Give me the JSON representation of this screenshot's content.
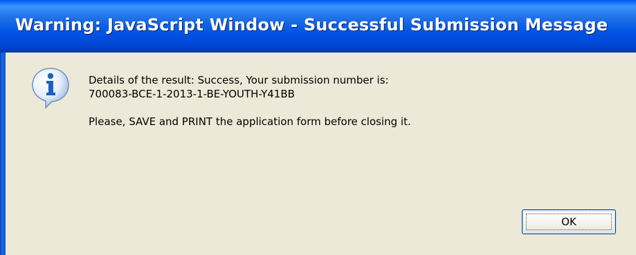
{
  "window": {
    "title": "Warning: JavaScript Window - Successful Submission Message"
  },
  "dialog": {
    "icon": "info-balloon-icon",
    "message_line_1": "Details of the result: Success, Your submission number is:",
    "message_line_2": "700083-BCE-1-2013-1-BE-YOUTH-Y41BB",
    "message_line_3": "Please, SAVE and PRINT the application form before closing it.",
    "ok_label": "OK"
  },
  "colors": {
    "titlebar": "#0055e5",
    "client": "#ece9d8",
    "button_border": "#003c74"
  }
}
